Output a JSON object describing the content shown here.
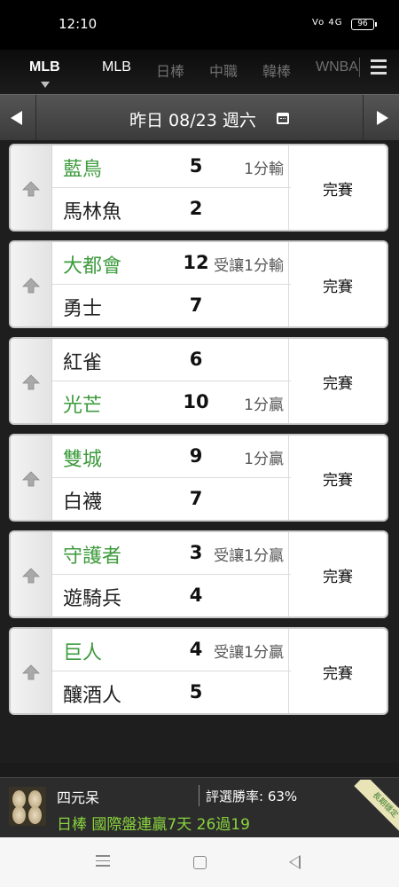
{
  "status_bar": {
    "time": "12:10",
    "signal": "Vo 4G",
    "battery": "96"
  },
  "tabs": [
    "MLB",
    "MLB",
    "日棒",
    "中職",
    "韓棒",
    "WNBA"
  ],
  "date_bar": {
    "label": "昨日 08/23 週六"
  },
  "games": [
    {
      "away": "藍鳥",
      "away_score": "5",
      "away_line": "1分輸",
      "away_green": true,
      "home": "馬林魚",
      "home_score": "2",
      "home_line": "",
      "home_green": false,
      "status": "完賽"
    },
    {
      "away": "大都會",
      "away_score": "12",
      "away_line": "受讓1分輸",
      "away_green": true,
      "home": "勇士",
      "home_score": "7",
      "home_line": "",
      "home_green": false,
      "status": "完賽"
    },
    {
      "away": "紅雀",
      "away_score": "6",
      "away_line": "",
      "away_green": false,
      "home": "光芒",
      "home_score": "10",
      "home_line": "1分贏",
      "home_green": true,
      "status": "完賽"
    },
    {
      "away": "雙城",
      "away_score": "9",
      "away_line": "1分贏",
      "away_green": true,
      "home": "白襪",
      "home_score": "7",
      "home_line": "",
      "home_green": false,
      "status": "完賽"
    },
    {
      "away": "守護者",
      "away_score": "3",
      "away_line": "受讓1分贏",
      "away_green": true,
      "home": "遊騎兵",
      "home_score": "4",
      "home_line": "",
      "home_green": false,
      "status": "完賽"
    },
    {
      "away": "巨人",
      "away_score": "4",
      "away_line": "受讓1分贏",
      "away_green": true,
      "home": "釀酒人",
      "home_score": "5",
      "home_line": "",
      "home_green": false,
      "status": "完賽"
    }
  ],
  "banner": {
    "name": "四元呆",
    "rate": "評選勝率: 63%",
    "message": "日棒 國際盤連贏7天 26過19",
    "badge": "長期穩定"
  },
  "colors": {
    "green_team": "#3e9b3e",
    "banner_msg": "#8ad43e"
  }
}
